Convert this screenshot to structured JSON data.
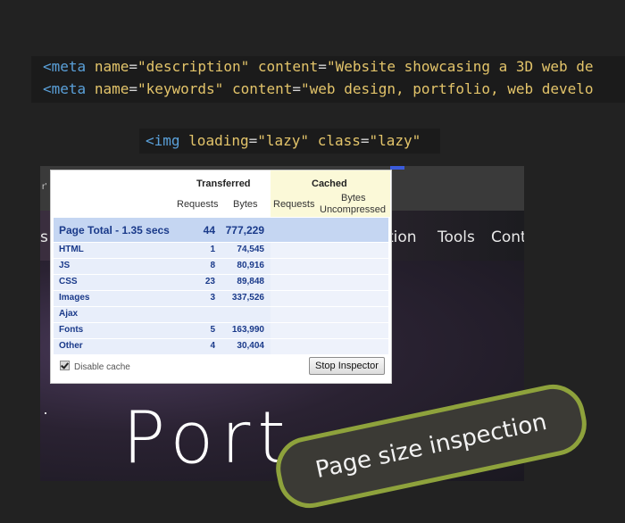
{
  "code": {
    "line1": {
      "open": "<meta",
      "attr1": "name",
      "val1": "\"description\"",
      "attr2": "content",
      "val2": "\"Website showcasing a 3D web de"
    },
    "line2": {
      "open": "<meta",
      "attr1": "name",
      "val1": "\"keywords\"",
      "attr2": "content",
      "val2": "\"web design, portfolio, web develo"
    },
    "inline": {
      "open": "<img",
      "attr1": "loading",
      "val1": "\"lazy\"",
      "attr2": "class",
      "val2": "\"lazy\""
    }
  },
  "site": {
    "topbar_fragment": "r'",
    "nav_fragment": "s",
    "nav": [
      "tion",
      "Tools",
      "Cont"
    ],
    "hero_title": "Port  f  o  o",
    "hero_title_visible": "Port"
  },
  "inspector": {
    "headers": {
      "transferred": "Transferred",
      "cached": "Cached",
      "requests": "Requests",
      "bytes": "Bytes",
      "cached_requests": "Requests",
      "bytes_uncompressed_1": "Bytes",
      "bytes_uncompressed_2": "Uncompressed"
    },
    "total": {
      "label": "Page Total - 1.35 secs",
      "requests": "44",
      "bytes": "777,229"
    },
    "rows": [
      {
        "label": "HTML",
        "requests": "1",
        "bytes": "74,545"
      },
      {
        "label": "JS",
        "requests": "8",
        "bytes": "80,916"
      },
      {
        "label": "CSS",
        "requests": "23",
        "bytes": "89,848"
      },
      {
        "label": "Images",
        "requests": "3",
        "bytes": "337,526"
      },
      {
        "label": "Ajax",
        "requests": "",
        "bytes": ""
      },
      {
        "label": "Fonts",
        "requests": "5",
        "bytes": "163,990"
      },
      {
        "label": "Other",
        "requests": "4",
        "bytes": "30,404"
      }
    ],
    "disable_cache": {
      "label": "Disable cache",
      "checked": true
    },
    "stop_button": "Stop Inspector"
  },
  "caption": "Page size inspection",
  "colors": {
    "background": "#222222",
    "tag": "#5aa0d9",
    "attr": "#e3c46a",
    "total_row": "#c5d6f2",
    "cached_header": "#fbf9d8",
    "badge_border": "#8ea23c",
    "badge_fill": "#3b3a35"
  }
}
